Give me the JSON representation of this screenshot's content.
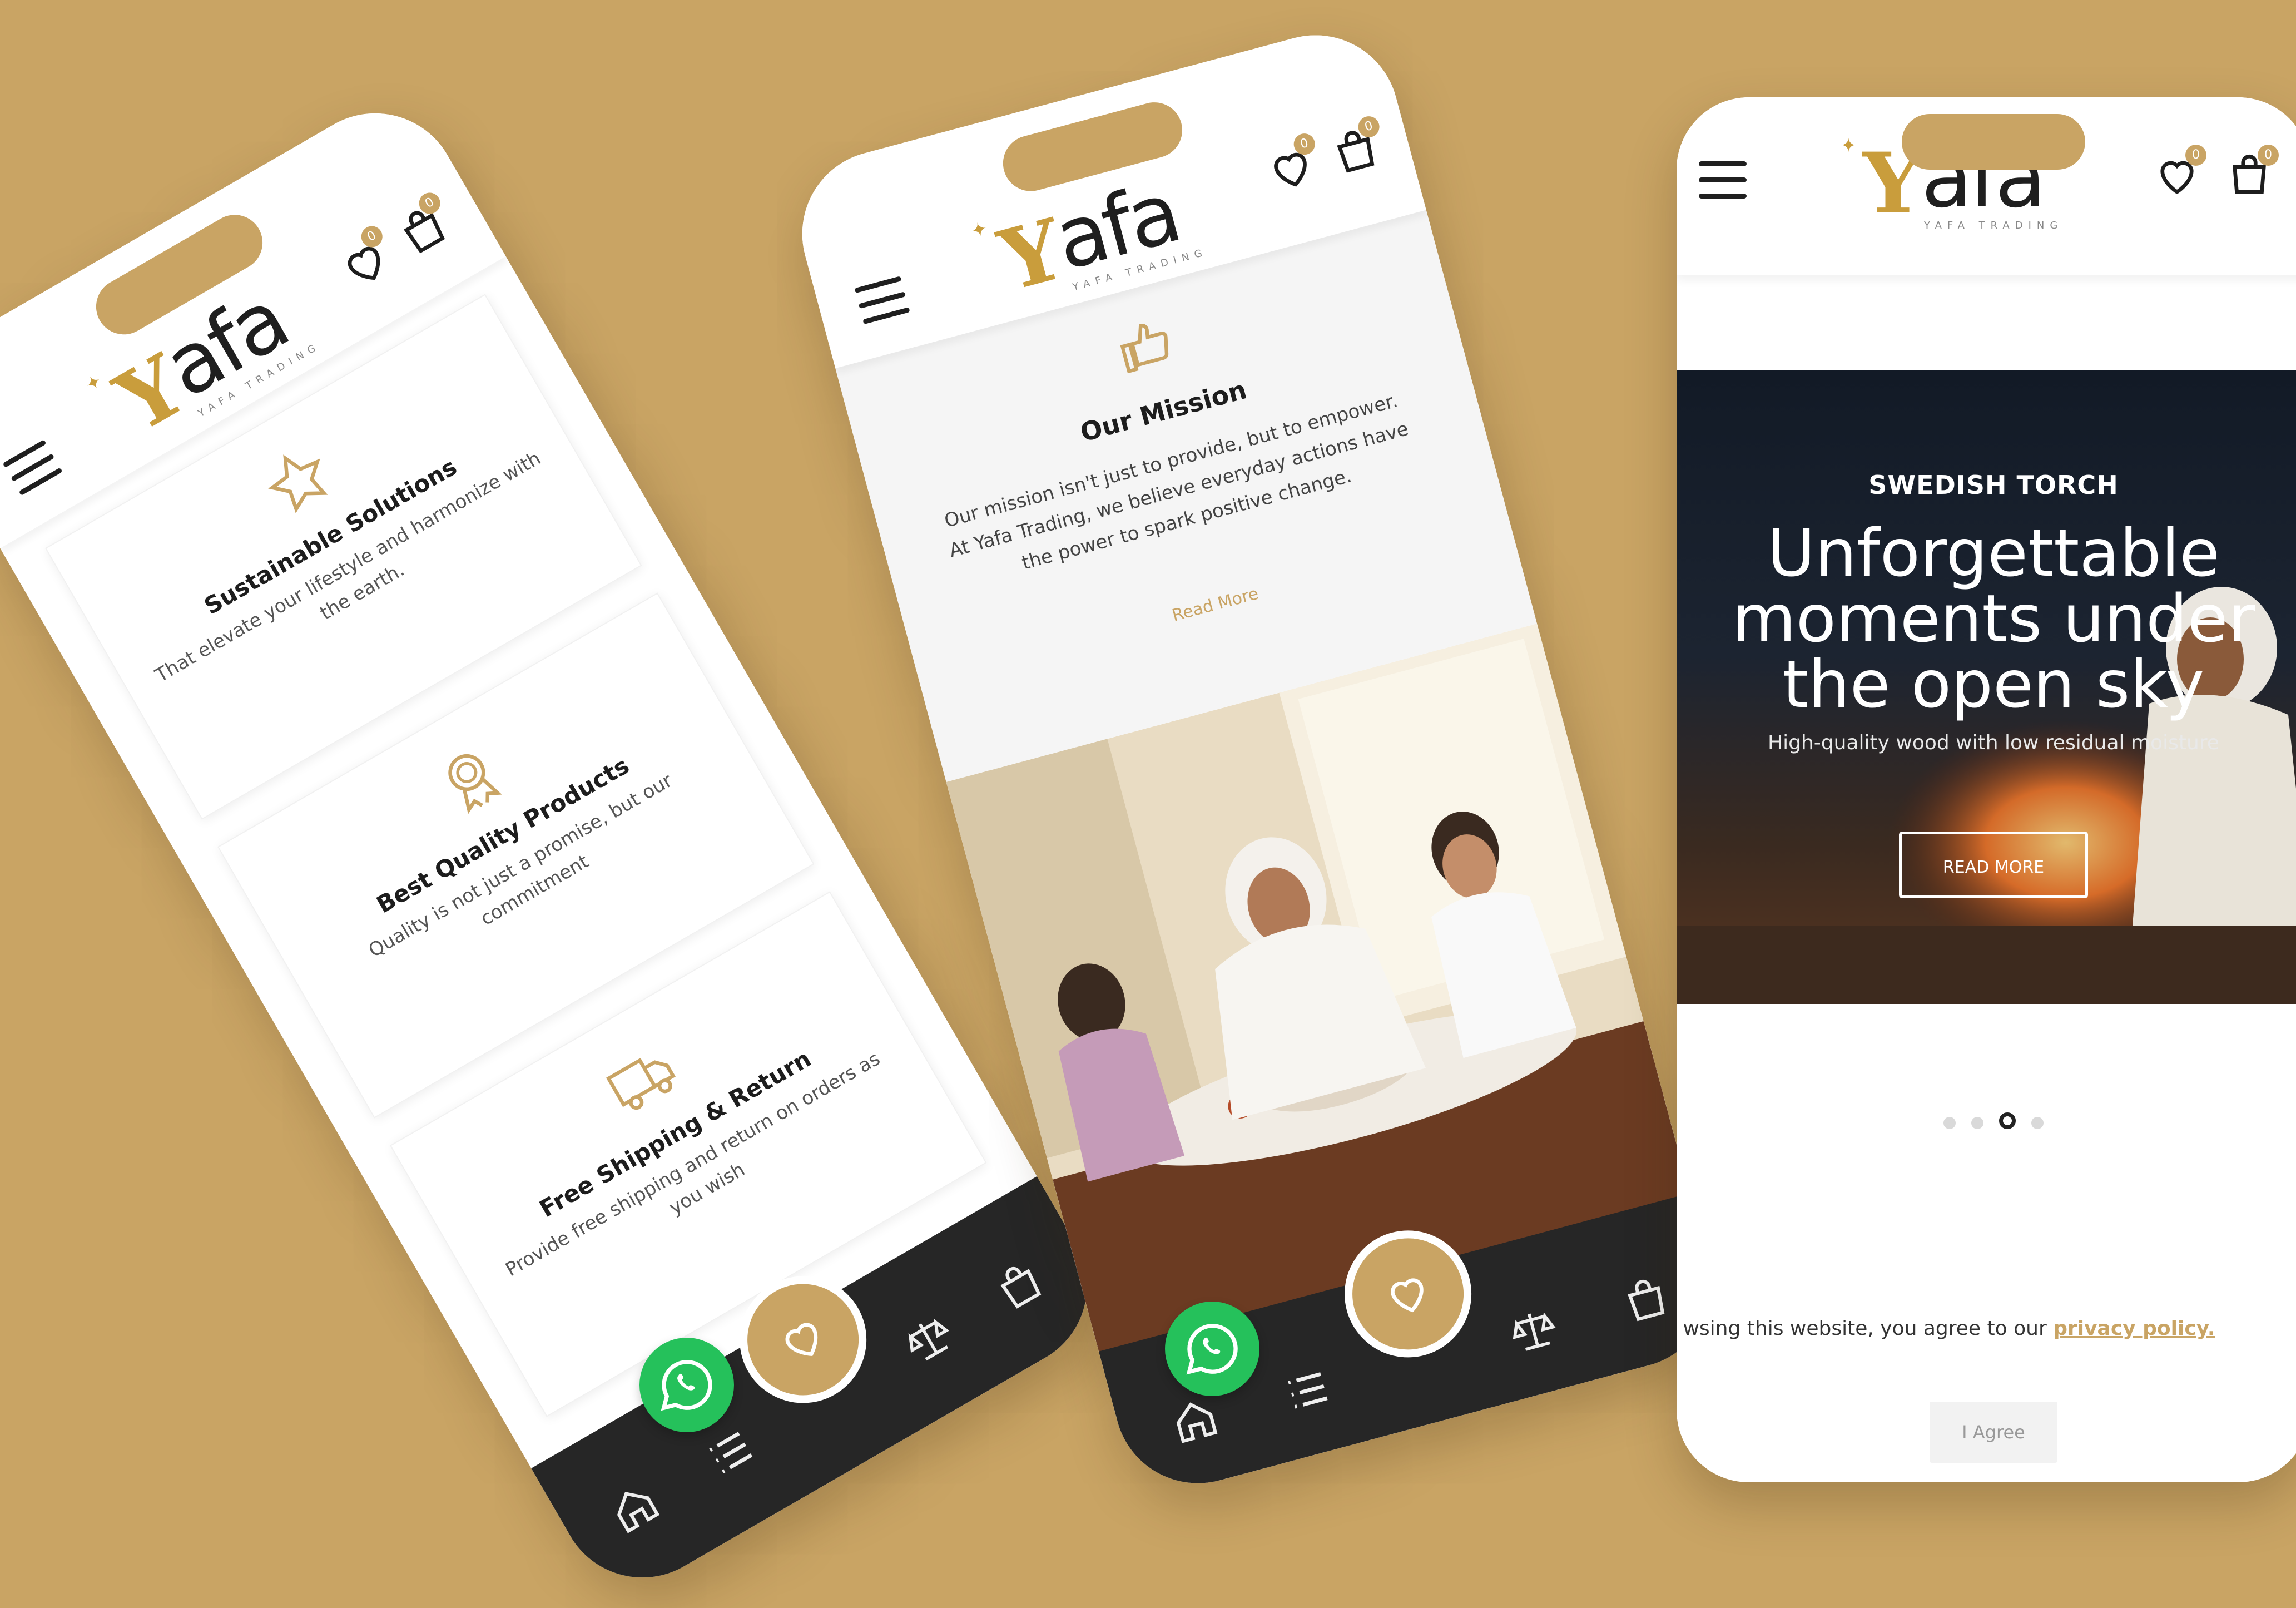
{
  "background_color": "#c9a464",
  "accent_color": "#c9a464",
  "brand": {
    "logo_initial": "Y",
    "logo_rest": "afa",
    "logo_sub": "YAFA TRADING"
  },
  "header_counts": {
    "wishlist": "0",
    "cart": "0"
  },
  "phone1": {
    "features": [
      {
        "icon": "star-icon",
        "title": "Sustainable Solutions",
        "desc": "That elevate your lifestyle and harmonize with the earth."
      },
      {
        "icon": "award-badge-icon",
        "title": "Best Quality Products",
        "desc": "Quality is not just a promise, but our commitment"
      },
      {
        "icon": "delivery-truck-icon",
        "title": "Free Shipping & Return",
        "desc": "Provide free shipping and return on orders as you wish"
      }
    ]
  },
  "phone2": {
    "mission_title": "Our Mission",
    "mission_text": "Our mission isn't just to provide, but to empower. At Yafa Trading, we believe everyday actions have the power to spark positive change.",
    "read_more": "Read More"
  },
  "phone3": {
    "slide_kicker": "SWEDISH TORCH",
    "slide_title": "Unforgettable moments under the open sky",
    "slide_subtitle": "High-quality wood with low residual moisture",
    "slide_button": "READ MORE",
    "slide_count": 4,
    "active_slide": 3,
    "cookie_text": "wsing this website, you agree to our",
    "cookie_link": "privacy policy.",
    "agree_button": "I Agree"
  },
  "icons": {
    "menu": "hamburger-icon",
    "wishlist": "heart-icon",
    "cart": "shopping-bag-icon",
    "home": "home-icon",
    "categories": "list-icon",
    "compare": "scale-icon",
    "whatsapp": "whatsapp-icon"
  }
}
